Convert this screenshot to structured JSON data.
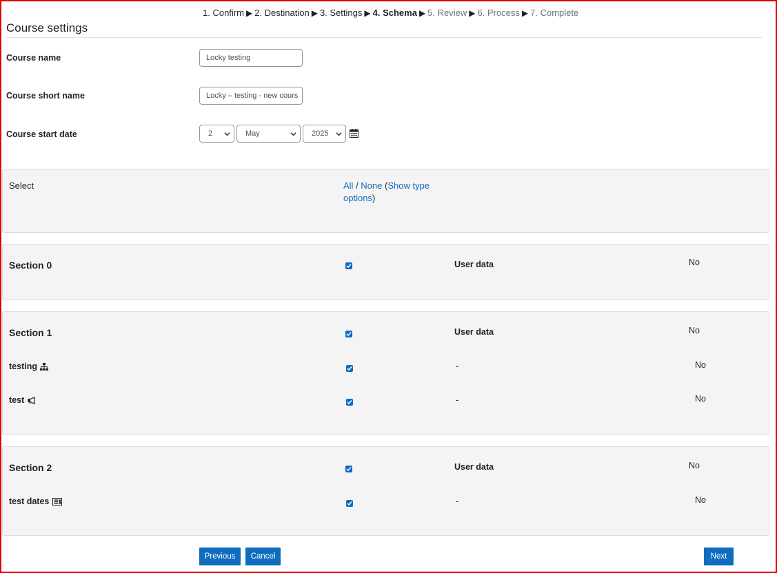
{
  "steps": [
    {
      "label": "1. Confirm",
      "state": "done"
    },
    {
      "label": "2. Destination",
      "state": "done"
    },
    {
      "label": "3. Settings",
      "state": "done"
    },
    {
      "label": "4. Schema",
      "state": "current"
    },
    {
      "label": "5. Review",
      "state": "future"
    },
    {
      "label": "6. Process",
      "state": "future"
    },
    {
      "label": "7. Complete",
      "state": "future"
    }
  ],
  "step_separator": "▶",
  "course_settings": {
    "heading": "Course settings",
    "course_name_label": "Course name",
    "course_name_value": "Locky testing",
    "short_name_label": "Course short name",
    "short_name_value": "Locky – testing - new cours",
    "start_date_label": "Course start date",
    "day": "2",
    "month": "May",
    "year": "2025",
    "calendar_icon": "calendar-icon"
  },
  "select_panel": {
    "label": "Select",
    "all": "All",
    "slash": " / ",
    "none": "None",
    "open_paren": " (",
    "show_type": "Show type",
    "options": "options",
    "close_paren": ")"
  },
  "sections": [
    {
      "title": "Section 0",
      "checked": true,
      "column_label": "User data",
      "column_value": "No",
      "activities": []
    },
    {
      "title": "Section 1",
      "checked": true,
      "column_label": "User data",
      "column_value": "No",
      "activities": [
        {
          "name": "testing",
          "icon": "hierarchy-icon",
          "checked": true,
          "dash": "-",
          "value": "No"
        },
        {
          "name": "test",
          "icon": "megaphone-icon",
          "checked": true,
          "dash": "-",
          "value": "No"
        }
      ]
    },
    {
      "title": "Section 2",
      "checked": true,
      "column_label": "User data",
      "column_value": "No",
      "activities": [
        {
          "name": "test dates",
          "icon": "database-icon",
          "checked": true,
          "dash": "-",
          "value": "No"
        }
      ]
    }
  ],
  "buttons": {
    "previous": "Previous",
    "cancel": "Cancel",
    "next": "Next"
  },
  "colors": {
    "primary": "#0f6cbf",
    "frame": "#e00000",
    "panel_bg": "#f4f4f4"
  }
}
